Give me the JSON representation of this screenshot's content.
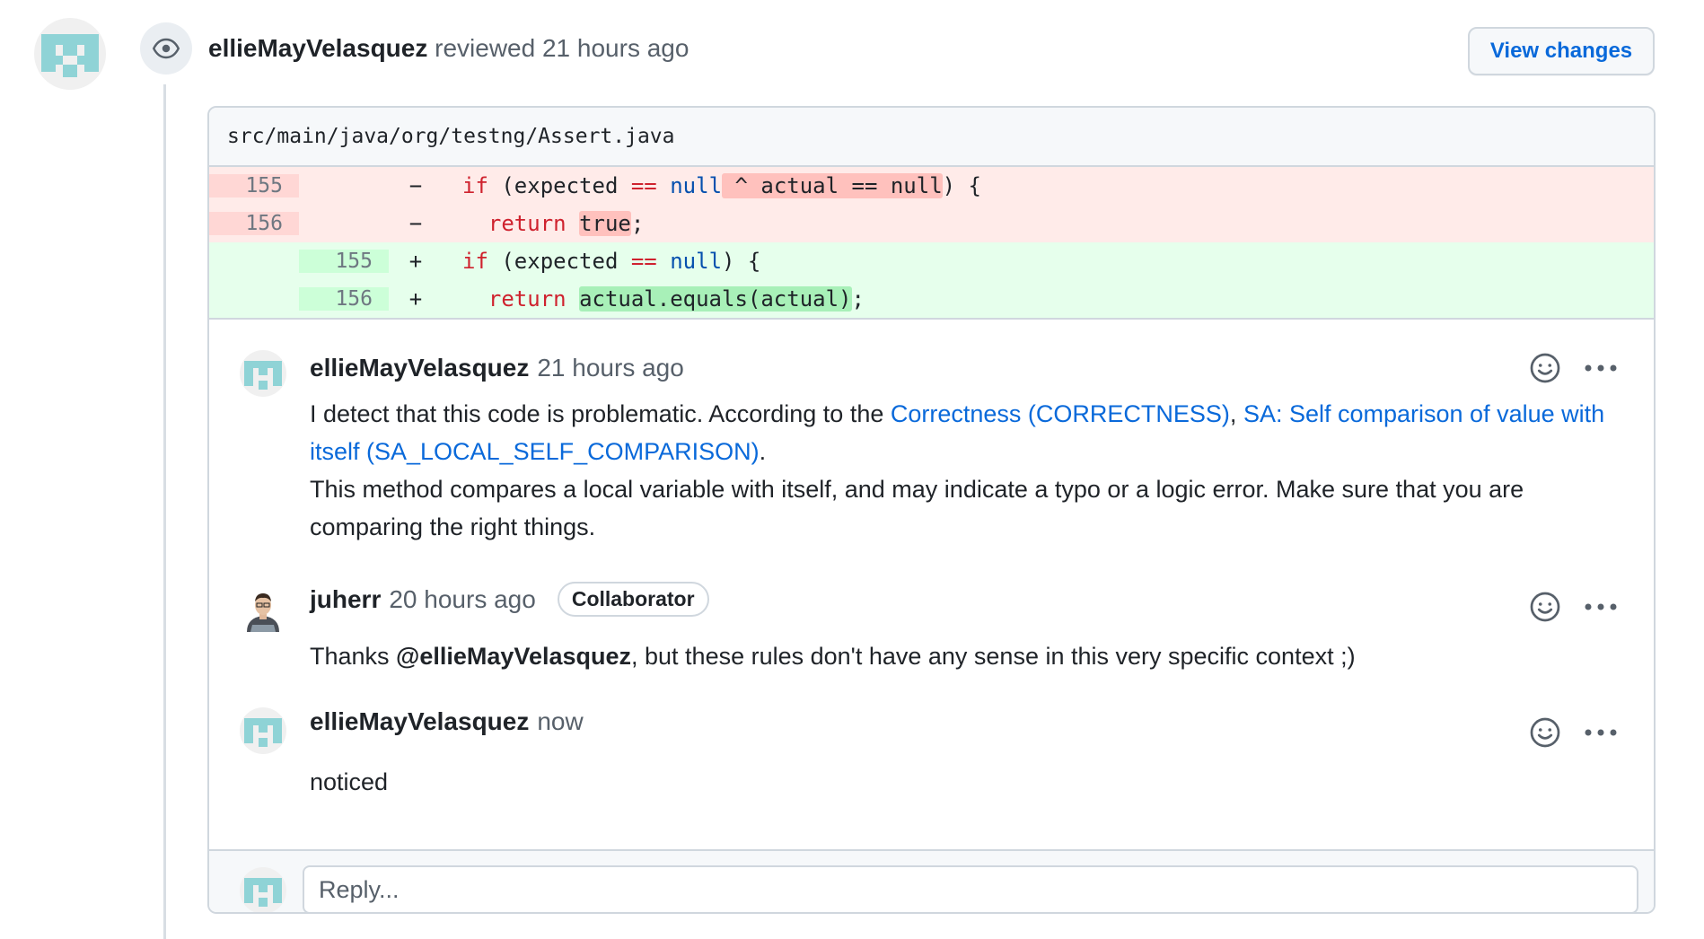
{
  "review": {
    "reviewer": "ellieMayVelasquez",
    "action": "reviewed",
    "time": "21 hours ago",
    "view_changes_label": "View changes"
  },
  "file": {
    "path": "src/main/java/org/testng/Assert.java"
  },
  "diff": {
    "lines": [
      {
        "type": "del",
        "old": "155",
        "new": "",
        "sign": "−"
      },
      {
        "type": "del",
        "old": "156",
        "new": "",
        "sign": "−"
      },
      {
        "type": "add",
        "old": "",
        "new": "155",
        "sign": "+"
      },
      {
        "type": "add",
        "old": "",
        "new": "156",
        "sign": "+"
      }
    ],
    "tokens": {
      "if": "if",
      "expected": "(expected",
      "eqeq": "==",
      "null": "null",
      "xor_actual": " ^ actual == null",
      "close_brace": ") {",
      "close_paren_brace": ") {",
      "return": "return",
      "true": "true",
      "semicolon": ";",
      "actual_equals": "actual.equals(actual)",
      "semicolon2": ";"
    }
  },
  "comments": [
    {
      "author": "ellieMayVelasquez",
      "time": "21 hours ago",
      "body_prefix": "I detect that this code is problematic. According to the ",
      "link1": "Correctness (CORRECTNESS)",
      "sep": ", ",
      "link2": "SA: Self comparison of value with itself (SA_LOCAL_SELF_COMPARISON)",
      "period": ".",
      "body_second": "This method compares a local variable with itself, and may indicate a typo or a logic error. Make sure that you are comparing the right things."
    },
    {
      "author": "juherr",
      "time": "20 hours ago",
      "badge": "Collaborator",
      "body_prefix": "Thanks ",
      "mention": "@ellieMayVelasquez",
      "body_suffix": ", but these rules don't have any sense in this very specific context ;)"
    },
    {
      "author": "ellieMayVelasquez",
      "time": "now",
      "body": "noticed"
    }
  ],
  "reply": {
    "placeholder": "Reply..."
  },
  "colors": {
    "link": "#0969da",
    "deleted_bg": "#ffebe9",
    "added_bg": "#e6ffec",
    "avatar_identicon": "#8fd3d6"
  }
}
